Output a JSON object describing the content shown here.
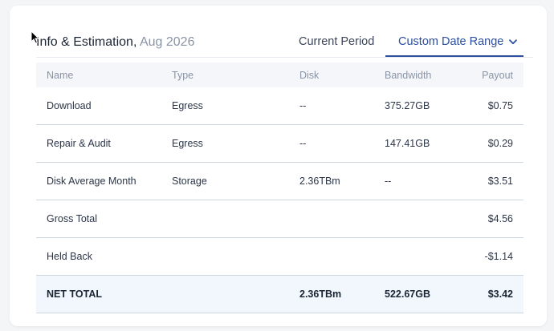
{
  "header": {
    "title": "Info & Estimation,",
    "period": "Aug 2026",
    "tabs": {
      "current": "Current Period",
      "custom": "Custom Date Range"
    }
  },
  "table": {
    "columns": {
      "name": "Name",
      "type": "Type",
      "disk": "Disk",
      "bandwidth": "Bandwidth",
      "payout": "Payout"
    },
    "rows": [
      {
        "name": "Download",
        "type": "Egress",
        "disk": "--",
        "bandwidth": "375.27GB",
        "payout": "$0.75"
      },
      {
        "name": "Repair & Audit",
        "type": "Egress",
        "disk": "--",
        "bandwidth": "147.41GB",
        "payout": "$0.29"
      },
      {
        "name": "Disk Average Month",
        "type": "Storage",
        "disk": "2.36TBm",
        "bandwidth": "--",
        "payout": "$3.51"
      },
      {
        "name": "Gross Total",
        "type": "",
        "disk": "",
        "bandwidth": "",
        "payout": "$4.56"
      },
      {
        "name": "Held Back",
        "type": "",
        "disk": "",
        "bandwidth": "",
        "payout": "-$1.14"
      }
    ],
    "total": {
      "name": "NET TOTAL",
      "disk": "2.36TBm",
      "bandwidth": "522.67GB",
      "payout": "$3.42"
    }
  },
  "colors": {
    "accent": "#2c4f9e",
    "total_row_bg": "#f1f7fd",
    "header_bg": "#f5f6fa"
  },
  "icons": {
    "dropdown": "chevron-down-icon",
    "cursor": "mouse-pointer-icon"
  }
}
